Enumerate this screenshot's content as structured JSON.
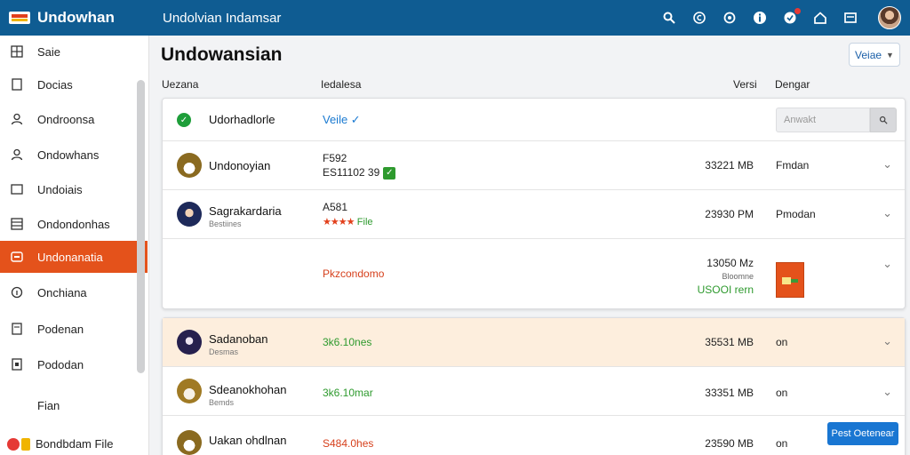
{
  "topbar": {
    "brand": "Undowhan",
    "title": "Undolvian Indamsar",
    "icons": [
      "search-icon",
      "copyright-icon",
      "settings-icon",
      "info-icon",
      "notification-icon",
      "home-icon",
      "message-icon"
    ]
  },
  "sidebar": {
    "items": [
      {
        "label": "Saie",
        "icon": "grid-icon"
      },
      {
        "label": "Docias",
        "icon": "document-icon"
      },
      {
        "label": "Ondroonsa",
        "icon": "user-icon"
      },
      {
        "label": "Ondowhans",
        "icon": "user-icon"
      },
      {
        "label": "Undoiais",
        "icon": "document-icon"
      },
      {
        "label": "Ondondonhas",
        "icon": "list-icon"
      },
      {
        "label": "Undonanatia",
        "icon": "folder-icon",
        "active": true
      },
      {
        "label": "Onchiana",
        "icon": "info-icon"
      },
      {
        "label": "Podenan",
        "icon": "document-icon"
      },
      {
        "label": "Pododan",
        "icon": "image-icon"
      },
      {
        "label": "Fian",
        "icon": ""
      }
    ],
    "footer": "Bondbdam File"
  },
  "main": {
    "title": "Undowansian",
    "version_label": "Veiae",
    "columns": {
      "name": "Uezana",
      "status": "Iedalesa",
      "size": "Versi",
      "dept": "Dengar"
    },
    "search_placeholder": "Anwakt"
  },
  "rows": [
    {
      "name": "Udorhadlorle",
      "status": "Veile ✓",
      "type": "header"
    },
    {
      "name": "Undonoyian",
      "status_line1": "F592",
      "status_line2": "ES11102 39",
      "size": "33221 MB",
      "dept": "Fmdan"
    },
    {
      "name": "Sagrakardaria",
      "sub": "Bestiines",
      "status_line1": "A581",
      "status_stars": "★★★★",
      "status_file": "File",
      "size": "23930 PM",
      "dept": "Pmodan"
    },
    {
      "status": "Pkzcondomo",
      "size_line1": "13050 Mz",
      "size_line2": "Bloomne",
      "size_line3": "USOOI rern"
    },
    {
      "name": "Sadanoban",
      "sub": "Desmas",
      "status": "3k6.10nes",
      "size": "35531 MB",
      "dept": "on"
    },
    {
      "name": "Sdeanokhohan",
      "sub": "Bemds",
      "status": "3k6.10mar",
      "size": "33351 MB",
      "dept": "on"
    },
    {
      "name": "Uakan ohdlnan",
      "status": "S484.0hes",
      "size": "23590 MB",
      "dept": "on"
    }
  ],
  "action_button": "Pest Oetenear"
}
